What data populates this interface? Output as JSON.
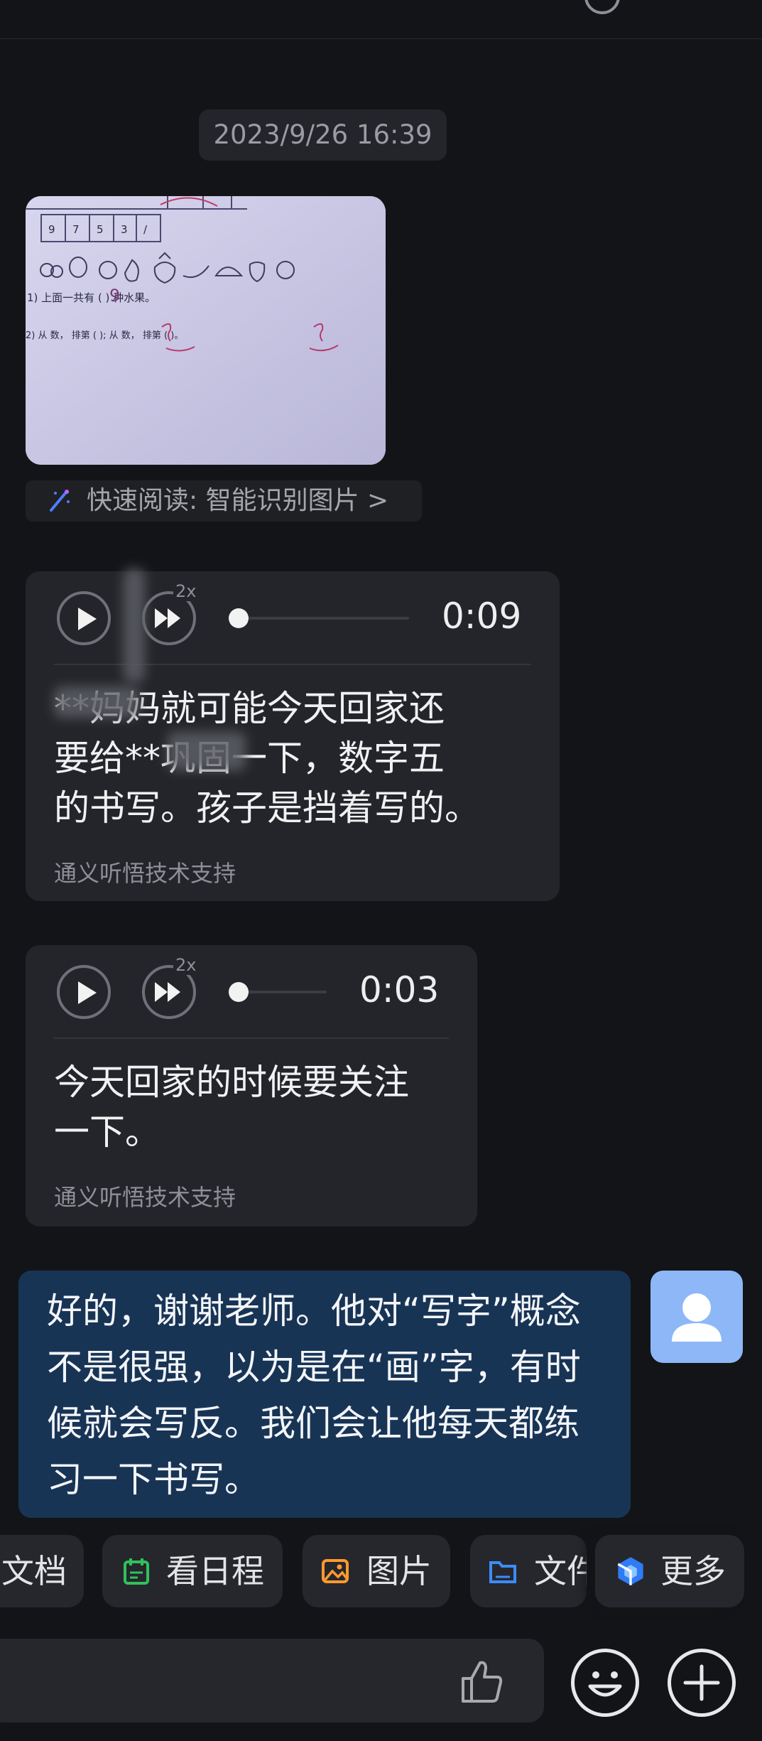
{
  "chat": {
    "timestamp": "2023/9/26 16:39",
    "quick_read": "快速阅读: 智能识别图片 >",
    "photo_content": {
      "q1": "1) 上面一共有 (   ) 种水果。",
      "q1_answer": "9",
      "q2": "2) 从     数，      排第 (      ); 从      数，      排第 (      )。",
      "grid_values": [
        "9",
        "7",
        "5",
        "3",
        "/"
      ]
    },
    "voice_messages": [
      {
        "duration": "0:09",
        "speed": "2x",
        "transcript": "**妈妈就可能今天回家还要给**巩固一下，数字五的书写。孩子是挡着写的。",
        "line1": "**妈妈就可能今天回家还",
        "line2": "要给**巩固一下，数字五",
        "line3": "的书写。孩子是挡着写的。",
        "credit": "通义听悟技术支持"
      },
      {
        "duration": "0:03",
        "speed": "2x",
        "line1": "今天回家的时候要关注",
        "line2": "一下。",
        "credit": "通义听悟技术支持"
      }
    ],
    "my_message": {
      "line1": "好的，谢谢老师。他对“写字”概念",
      "line2": "不是很强，以为是在“画”字，有时",
      "line3": "候就会写反。我们会让他每天都练",
      "line4": "习一下书写。"
    }
  },
  "quick_actions": [
    {
      "label": "文档",
      "icon": "document-icon",
      "color": "#4c8dff"
    },
    {
      "label": "看日程",
      "icon": "calendar-icon",
      "color": "#2fc25b"
    },
    {
      "label": "图片",
      "icon": "image-icon",
      "color": "#ff9a2e"
    },
    {
      "label": "文件",
      "icon": "folder-icon",
      "color": "#3b8cff"
    },
    {
      "label": "更多",
      "icon": "more-icon",
      "color": "#3b8cff"
    }
  ],
  "input": {
    "icons": [
      "thumbs-up-icon",
      "emoji-icon",
      "plus-icon"
    ]
  }
}
